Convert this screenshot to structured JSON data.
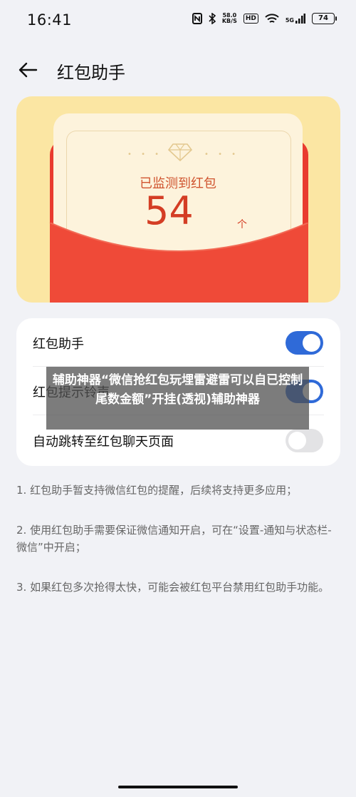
{
  "status_bar": {
    "time": "16:41",
    "net_speed_value": "58.0",
    "net_speed_unit": "KB/S",
    "hd_badge": "HD",
    "network_gen": "5G",
    "battery": "74"
  },
  "header": {
    "title": "红包助手"
  },
  "banner": {
    "monitor_label": "已监测到红包",
    "count": "54",
    "count_unit": "个"
  },
  "settings": {
    "items": [
      {
        "label": "红包助手",
        "enabled": true
      },
      {
        "label": "红包提示铃声",
        "enabled": true
      },
      {
        "label": "自动跳转至红包聊天页面",
        "enabled": false
      }
    ]
  },
  "overlay": {
    "text": "辅助神器“微信抢红包玩埋雷避雷可以自已控制尾数金额”开挂(透视)辅助神器"
  },
  "notes": [
    "1. 红包助手暂支持微信红包的提醒，后续将支持更多应用；",
    "2. 使用红包助手需要保证微信通知开启，可在“设置-通知与状态栏-微信”中开启；",
    "3. 如果红包多次抢得太快，可能会被红包平台禁用红包助手功能。"
  ],
  "colors": {
    "accent": "#2f6ad8",
    "banner_bg": "#fbe6a3",
    "envelope_red": "#e93b2f",
    "count_red": "#d43d24"
  }
}
